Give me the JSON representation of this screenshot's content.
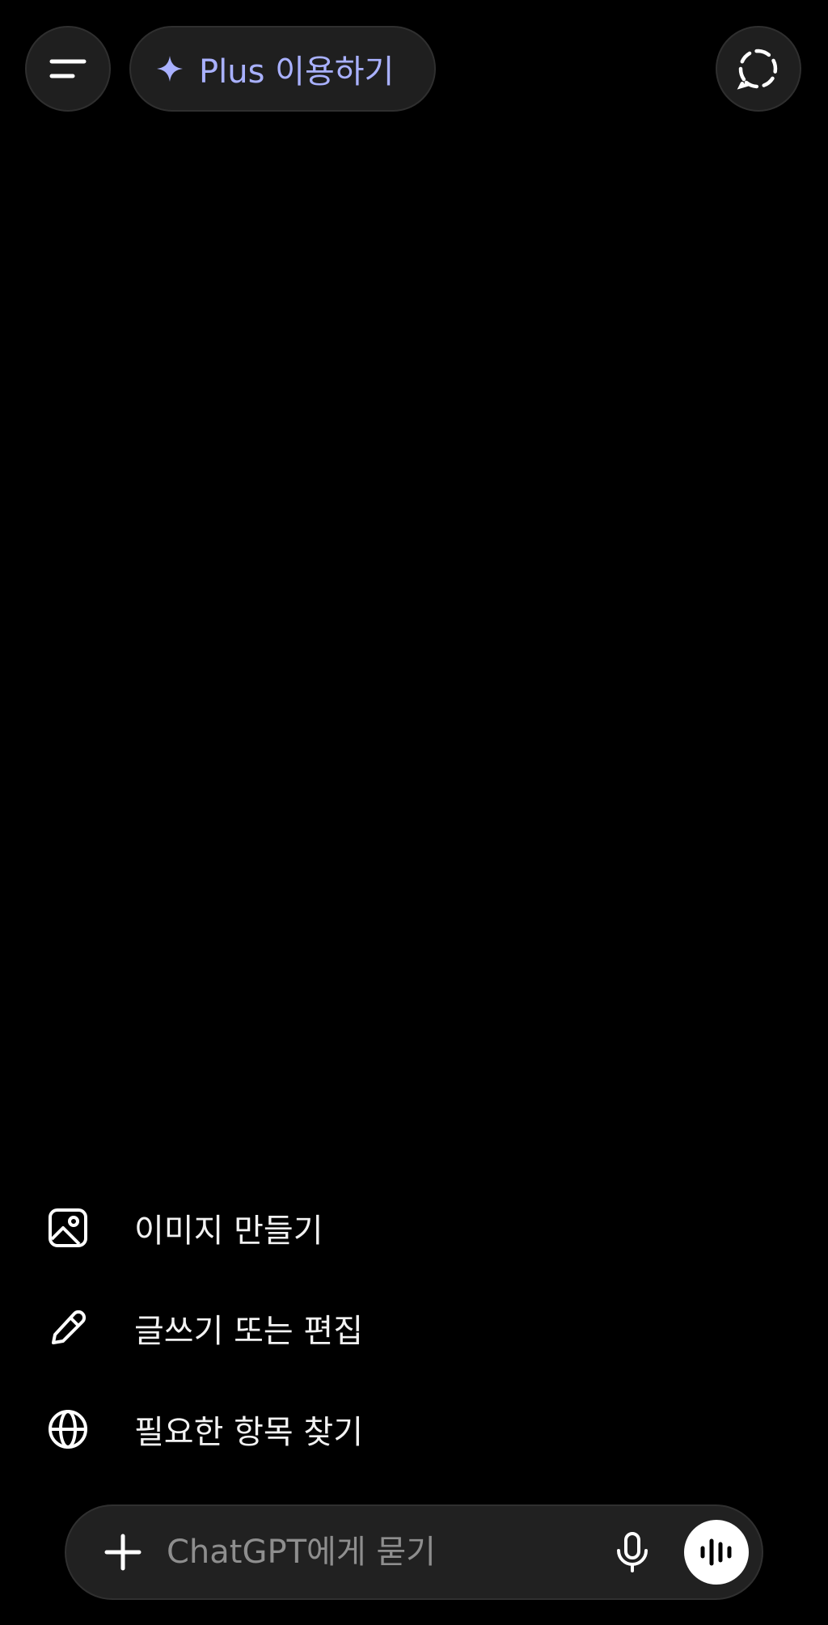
{
  "header": {
    "upgrade_label": "Plus 이용하기"
  },
  "suggestions": [
    {
      "label": "이미지 만들기",
      "icon": "image-icon"
    },
    {
      "label": "글쓰기 또는 편집",
      "icon": "pencil-icon"
    },
    {
      "label": "필요한 항목 찾기",
      "icon": "globe-icon"
    }
  ],
  "composer": {
    "placeholder": "ChatGPT에게 묻기"
  },
  "colors": {
    "background": "#000000",
    "surface": "#1f1f1f",
    "accent": "#a9b1ff",
    "text": "#ffffff"
  }
}
